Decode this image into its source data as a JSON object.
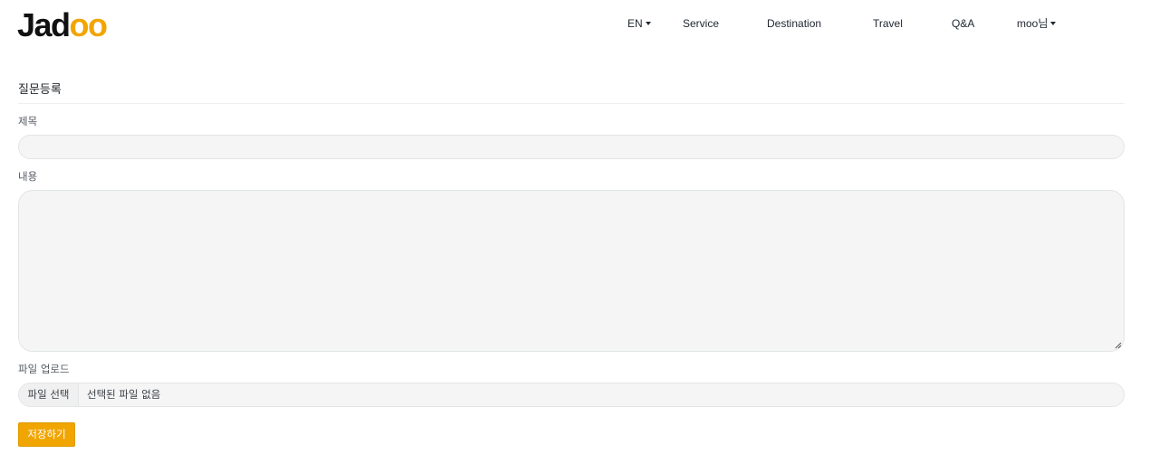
{
  "header": {
    "logo_main": "Jad",
    "logo_accent": "oo",
    "language": "EN",
    "nav": [
      "Service",
      "Destination",
      "Travel",
      "Q&A"
    ],
    "user_menu": "moo님"
  },
  "form": {
    "section_title": "질문등록",
    "title_label": "제목",
    "title_value": "",
    "content_label": "내용",
    "content_value": "",
    "file_label": "파일 업로드",
    "file_button": "파일 선택",
    "file_status": "선택된 파일 없음",
    "submit_label": "저장하기"
  },
  "colors": {
    "accent": "#f1a501",
    "input_bg": "#f5f5f5"
  }
}
